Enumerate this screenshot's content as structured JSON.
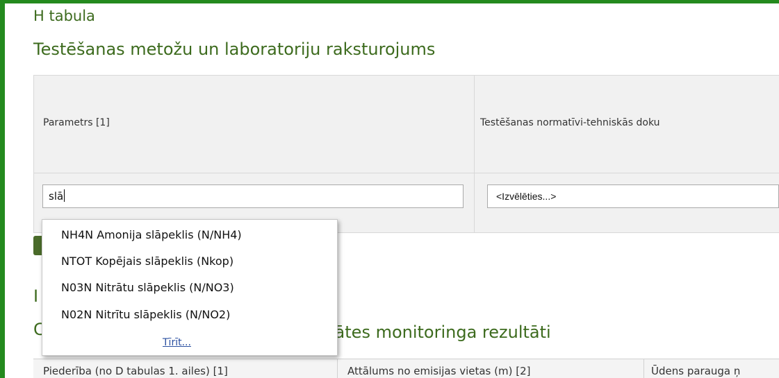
{
  "section": {
    "prefix": "H tabula",
    "title": "Testēšanas metožu un laboratoriju raksturojums"
  },
  "table": {
    "headers": [
      "Parametrs [1]",
      "Testēšanas normatīvi-tehniskās doku"
    ],
    "parameter_input_value": "slā",
    "method_select_value": "<Izvēlēties...>"
  },
  "autocomplete": {
    "items": [
      "NH4N Amonija slāpeklis (N/NH4)",
      "NTOT Kopējais slāpeklis (Nkop)",
      "N03N Nitrātu slāpeklis (N/NO3)",
      "N02N Nitrītu slāpeklis (N/NO2)"
    ],
    "clear_label": "Tīrīt..."
  },
  "next_section": {
    "letter_partial": "I",
    "title_partial": "C",
    "title_tail": "kvalitātes monitoringa rezultāti"
  },
  "bottom_table": {
    "headers": [
      "Piederība (no D tabulas 1. ailes) [1]",
      "Attālums no emisijas vietas (m) [2]",
      "Ūdens parauga ņ"
    ]
  },
  "colors": {
    "frame_green": "#248a1e",
    "heading_green": "#3d6b1e",
    "button_green": "#4a6b2a",
    "link_blue": "#2a4fa0"
  }
}
